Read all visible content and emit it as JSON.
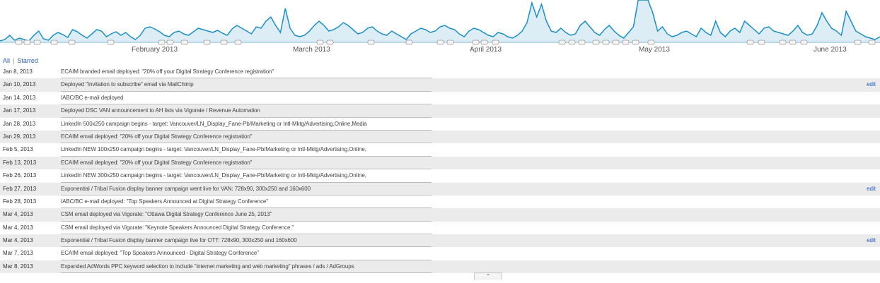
{
  "timeline": {
    "months": [
      "February 2013",
      "March 2013",
      "April 2013",
      "May 2013",
      "June 2013"
    ],
    "line_color": "#1a8fc9",
    "fill_color": "#dcedf5"
  },
  "filters": {
    "all_label": "All",
    "starred_label": "Starred"
  },
  "annotations": [
    {
      "date": "Jan 8, 2013",
      "text": "ECAIM branded email deployed: \"20% off your Digital Strategy Conference registration\"",
      "edit": ""
    },
    {
      "date": "Jan 10, 2013",
      "text": "Deployed \"Invitation to subscribe\" email via MailChimp",
      "edit": "edit"
    },
    {
      "date": "Jan 14, 2013",
      "text": "IABC/BC e-mail deployed",
      "edit": ""
    },
    {
      "date": "Jan 17, 2013",
      "text": "Deployed DSC VAN announcement to AH lists via Vigorate / Revenue Automation",
      "edit": ""
    },
    {
      "date": "Jan 28, 2013",
      "text": "LinkedIn 500x250 campaign begins - target: Vancouver/LN_Display_Fane-Pb/Marketing or Intl-Mktg/Advertising,Online,Media",
      "edit": ""
    },
    {
      "date": "Jan 29, 2013",
      "text": "ECAIM email deployed: \"20% off your Digital Strategy Conference registration\"",
      "edit": ""
    },
    {
      "date": "Feb 5, 2013",
      "text": "LinkedIn NEW 100x250 campaign begins - target: Vancouver/LN_Display_Fane-Pb/Marketing or Intl-Mktg/Advertising,Online,",
      "edit": ""
    },
    {
      "date": "Feb 13, 2013",
      "text": "ECAIM email deployed: \"20% off your Digital Strategy Conference registration\"",
      "edit": ""
    },
    {
      "date": "Feb 26, 2013",
      "text": "LinkedIn NEW 300x250 campaign begins - target: Vancouver/LN_Display_Fane-Pb/Marketing or Intl-Mktg/Advertising,Online,",
      "edit": ""
    },
    {
      "date": "Feb 27, 2013",
      "text": "Exponential / Tribal Fusion display banner campaign went live for VAN: 728x90, 300x250 and 160x600",
      "edit": "edit"
    },
    {
      "date": "Feb 28, 2013",
      "text": "IABC/BC e-mail deployed: \"Top Speakers Announced at Digital Strategy Conference\"",
      "edit": ""
    },
    {
      "date": "Mar 4, 2013",
      "text": "CSM email deployed via Vigorate: \"Ottawa Digital Strategy Conference June 25, 2013\"",
      "edit": ""
    },
    {
      "date": "Mar 4, 2013",
      "text": "CSM email deployed via Vigorate: \"Keynote Speakers Announced Digital Strategy Conference.\"",
      "edit": ""
    },
    {
      "date": "Mar 4, 2013",
      "text": "Exponential / Tribal Fusion display banner campaign live for OTT: 728x90, 300x250 and 160x600",
      "edit": "edit"
    },
    {
      "date": "Mar 7, 2013",
      "text": "ECAIM email deployed: \"Top Speakers Announced - Digital Strategy Conference\"",
      "edit": ""
    },
    {
      "date": "Mar 8, 2013",
      "text": "Expanded AdWords PPC keyword selection to include \"internet marketing and web marketing\" phrases / ads / AdGroups",
      "edit": ""
    }
  ],
  "collapse_label": "⌃"
}
